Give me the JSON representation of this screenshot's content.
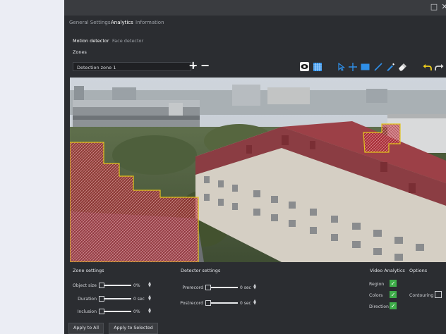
{
  "window": {
    "controls": [
      "□",
      "✕"
    ]
  },
  "tabs": [
    {
      "label": "General Settings",
      "active": false
    },
    {
      "label": "Analytics",
      "active": true
    },
    {
      "label": "Information",
      "active": false
    }
  ],
  "subtabs": [
    {
      "label": "Motion detector",
      "active": true
    },
    {
      "label": "Face detector",
      "active": false
    }
  ],
  "zones": {
    "label": "Zones",
    "selected_zone": "Detection zone 1",
    "add": "+",
    "remove": "−"
  },
  "toolbar": {
    "icons": [
      "eye-icon",
      "grid-icon",
      "pointer-icon",
      "crosshair-icon",
      "rectangle-icon",
      "line-icon",
      "pencil-icon",
      "eraser-icon",
      "undo-icon",
      "redo-icon"
    ],
    "accent": "#2f8fe8",
    "undo_color": "#f2d01b"
  },
  "video": {
    "zone_color": "#c0303a",
    "zone_border": "#e2c21a"
  },
  "zone_settings": {
    "title": "Zone settings",
    "rows": [
      {
        "label": "Object size",
        "value": "0%"
      },
      {
        "label": "Duration",
        "value": "0 sec"
      },
      {
        "label": "Inclusion",
        "value": "0%"
      }
    ]
  },
  "detector_settings": {
    "title": "Detector settings",
    "rows": [
      {
        "label": "Prerecord",
        "value": "0 sec"
      },
      {
        "label": "Postrecord",
        "value": "0 sec"
      }
    ]
  },
  "video_analytics": {
    "title": "Video Analytics",
    "items": [
      {
        "label": "Region",
        "checked": true
      },
      {
        "label": "Colors",
        "checked": true
      },
      {
        "label": "Direction",
        "checked": true
      }
    ]
  },
  "options": {
    "title": "Options",
    "items": [
      {
        "label": "Contouring",
        "checked": false
      }
    ]
  },
  "buttons": {
    "apply_all": "Apply to All",
    "apply_selected": "Apply to Selected"
  }
}
